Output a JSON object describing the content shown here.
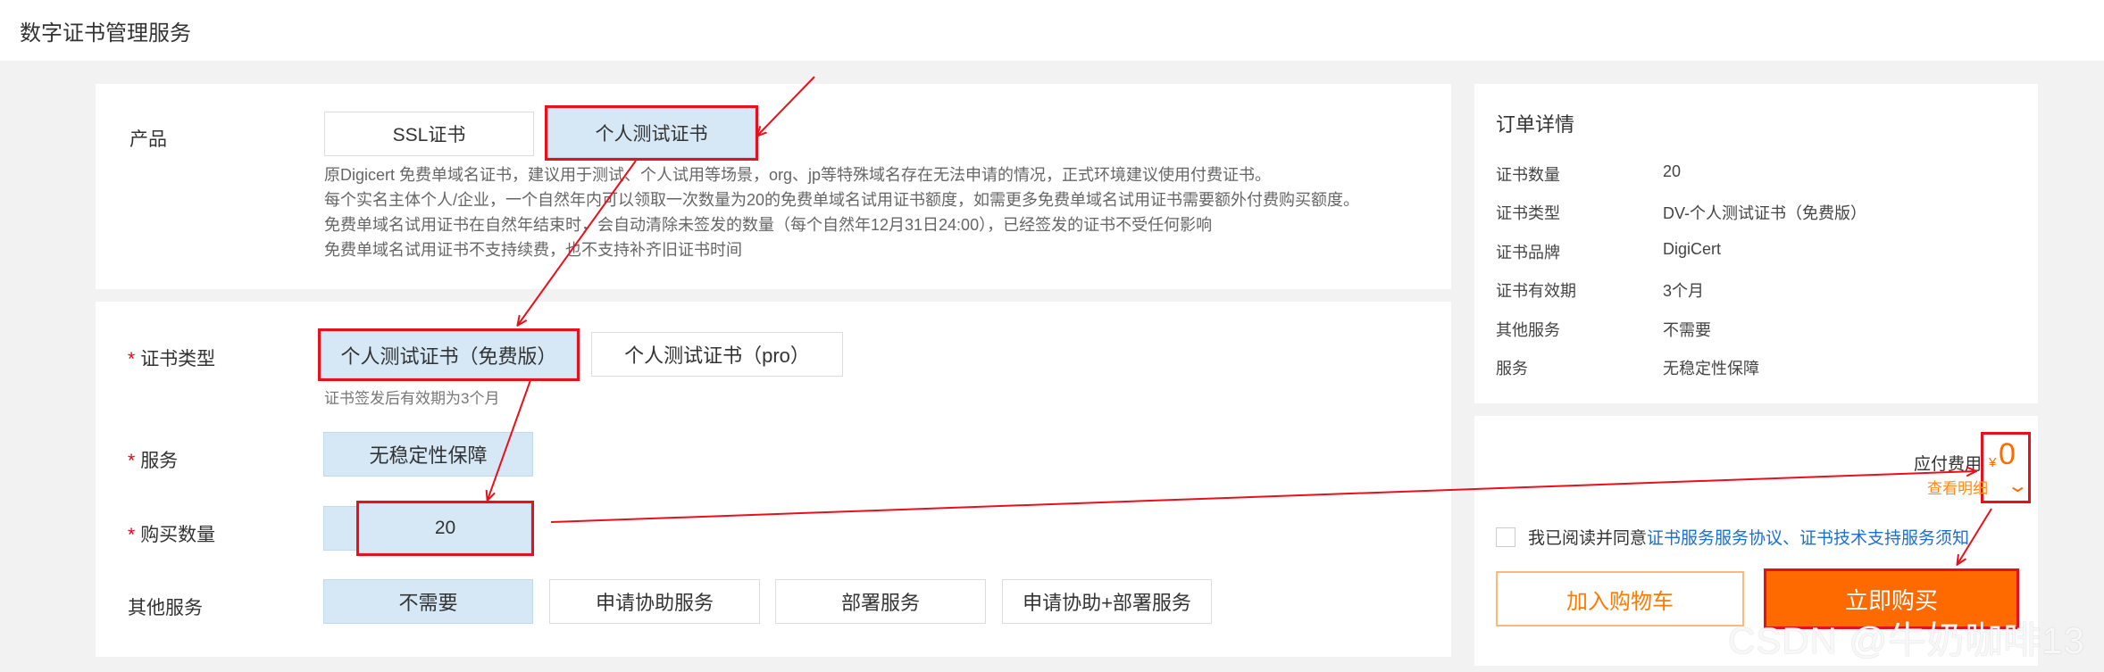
{
  "header": {
    "title": "数字证书管理服务"
  },
  "product": {
    "label": "产品",
    "options": [
      "SSL证书",
      "个人测试证书"
    ],
    "selected": "个人测试证书",
    "description": [
      "原Digicert 免费单域名证书，建议用于测试、个人试用等场景，org、jp等特殊域名存在无法申请的情况，正式环境建议使用付费证书。",
      "每个实名主体个人/企业，一个自然年内可以领取一次数量为20的免费单域名试用证书额度，如需更多免费单域名试用证书需要额外付费购买额度。",
      "免费单域名试用证书在自然年结束时，会自动清除未签发的数量（每个自然年12月31日24:00），已经签发的证书不受任何影响",
      "免费单域名试用证书不支持续费，也不支持补齐旧证书时间"
    ]
  },
  "form": {
    "cert_type": {
      "required_mark": "*",
      "label": "证书类型",
      "options": [
        "个人测试证书（免费版）",
        "个人测试证书（pro）"
      ],
      "hint": "证书签发后有效期为3个月"
    },
    "service": {
      "required_mark": "*",
      "label": "服务",
      "options": [
        "无稳定性保障"
      ]
    },
    "quantity": {
      "required_mark": "*",
      "label": "购买数量",
      "value": "20"
    },
    "other_service": {
      "label": "其他服务",
      "options": [
        "不需要",
        "申请协助服务",
        "部署服务",
        "申请协助+部署服务"
      ]
    }
  },
  "order": {
    "title": "订单详情",
    "rows": [
      {
        "key": "证书数量",
        "value": "20"
      },
      {
        "key": "证书类型",
        "value": "DV-个人测试证书（免费版）"
      },
      {
        "key": "证书品牌",
        "value": "DigiCert"
      },
      {
        "key": "证书有效期",
        "value": "3个月"
      },
      {
        "key": "其他服务",
        "value": "不需要"
      },
      {
        "key": "服务",
        "value": "无稳定性保障"
      }
    ]
  },
  "payment": {
    "due_label": "应付费用",
    "currency": "¥",
    "amount": "0",
    "detail_link": "查看明细",
    "agree_prefix": "我已阅读并同意",
    "agree_link1": "证书服务服务协议",
    "agree_sep": "、",
    "agree_link2": "证书技术支持服务须知",
    "cart_button": "加入购物车",
    "buy_button": "立即购买"
  },
  "watermark": "CSDN @牛奶咖啡13",
  "colors": {
    "accent": "#ff6a00",
    "selected_bg": "#d6e8f6",
    "annotation": "#e8101a",
    "link": "#1b6fd0"
  }
}
